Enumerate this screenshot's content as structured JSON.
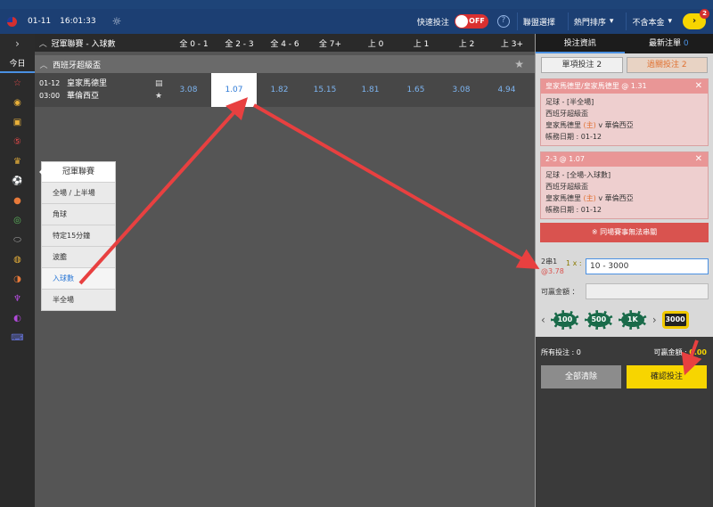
{
  "topbar": {
    "date": "01-11",
    "time": "16:01:33",
    "quick_bet_label": "快速投注",
    "toggle_state": "OFF",
    "league_select": "聯盟選擇",
    "sort": "熱門排序",
    "principal": "不含本金",
    "notif_count": "2"
  },
  "sidebar": {
    "today": "今日"
  },
  "header": {
    "title": "冠軍聯賽 - 入球數",
    "cols": [
      "全 0 - 1",
      "全 2 - 3",
      "全 4 - 6",
      "全 7+",
      "上 0",
      "上 1",
      "上 2",
      "上 3+"
    ]
  },
  "league": {
    "name": "西班牙超級盃"
  },
  "match": {
    "date": "01-12",
    "time": "03:00",
    "home": "皇家馬德里",
    "away": "華倫西亞",
    "odds": [
      "3.08",
      "1.07",
      "1.82",
      "15.15",
      "1.81",
      "1.65",
      "3.08",
      "4.94"
    ]
  },
  "popup": {
    "title": "冠軍聯賽",
    "items": [
      "全場 / 上半場",
      "角球",
      "特定15分鐘",
      "波膽",
      "入球數",
      "半全場"
    ]
  },
  "panel": {
    "tab_info": "投注資訊",
    "tab_latest": "最新注單",
    "latest_count": "0",
    "single": "單項投注 2",
    "parlay": "過關投注 2",
    "bets": [
      {
        "head": "皇家馬德里/皇家馬德里 @ 1.31",
        "line1": "足球 - [半全場]",
        "line2": "西班牙超級盃",
        "home": "皇家馬德里",
        "home_tag": "(主)",
        "vs": "v",
        "away": "華倫西亞",
        "date_label": "帳務日期 : 01-12"
      },
      {
        "head": "2-3 @ 1.07",
        "line1": "足球 - [全場-入球數]",
        "line2": "西班牙超級盃",
        "home": "皇家馬德里",
        "home_tag": "(主)",
        "vs": "v",
        "away": "華倫西亞",
        "date_label": "帳務日期 : 01-12"
      }
    ],
    "warning": "※ 同場賽事無法串關",
    "combo_label": "2串1",
    "combo_odds": "@3.78",
    "multiplier": "1 x :",
    "stake_placeholder": "10 - 3000",
    "win_label": "可贏金額",
    "chips": [
      "100",
      "500",
      "1K",
      "3000"
    ],
    "total_label": "所有投注 : 0",
    "win_total_label": "可贏金額 :",
    "win_total": "0.00",
    "clear": "全部清除",
    "confirm": "確認投注"
  }
}
